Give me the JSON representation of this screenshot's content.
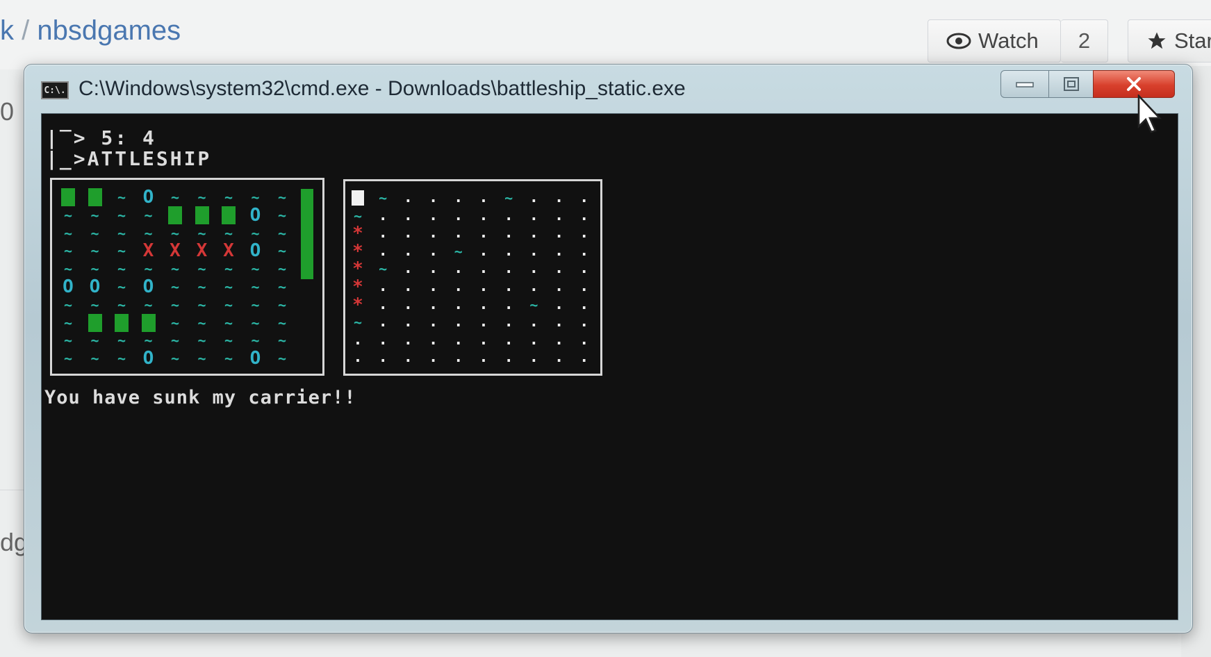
{
  "github": {
    "repo_prefix": "k",
    "repo_sep": "/",
    "repo_name": "nbsdgames",
    "watch_label": "Watch",
    "watch_count": "2",
    "star_label": "Star",
    "side_fragment_top": "0",
    "side_fragment_bottom": "dg"
  },
  "window": {
    "title": "C:\\Windows\\system32\\cmd.exe - Downloads\\battleship_static.exe",
    "icon_text": "C:\\.",
    "minimize_icon": "minimize-icon",
    "maximize_icon": "maximize-icon",
    "close_icon": "close-icon"
  },
  "console": {
    "logo_line1": "|‾> 5: 4",
    "logo_line2": "|_>ATTLESHIP",
    "message": "You have sunk my carrier!!",
    "player_board": [
      "S S ~ O ~ ~ ~ ~ ~",
      "~ ~ ~ ~ S S S O ~",
      "~ ~ ~ ~ ~ ~ ~ ~ ~",
      "~ ~ ~ X X X X O ~",
      "~ ~ ~ ~ ~ ~ ~ ~ ~",
      "O O ~ O ~ ~ ~ ~ ~",
      "~ ~ ~ ~ ~ ~ ~ ~ ~",
      "~ S S S ~ ~ ~ ~ ~",
      "~ ~ ~ ~ ~ ~ ~ ~ ~",
      "~ ~ ~ O ~ ~ ~ O ~"
    ],
    "enemy_board": [
      "# ~ . . . . ~ . . .",
      "~ . . . . . . . . .",
      "X . . . . . . . . .",
      "X . . . ~ . . . . .",
      "X ~ . . . . . . . .",
      "X . . . . . . . . .",
      "X . . . . . . ~ . .",
      "~ . . . . . . . . .",
      ". . . . . . . . . .",
      ". . . . . . . . . ."
    ]
  },
  "colors": {
    "ship": "#1f9e2c",
    "water": "#2bb6a6",
    "miss": "#31b3c9",
    "hit": "#d43737",
    "console_bg": "#111111",
    "close_button": "#d8402c",
    "link": "#4a77b0"
  }
}
